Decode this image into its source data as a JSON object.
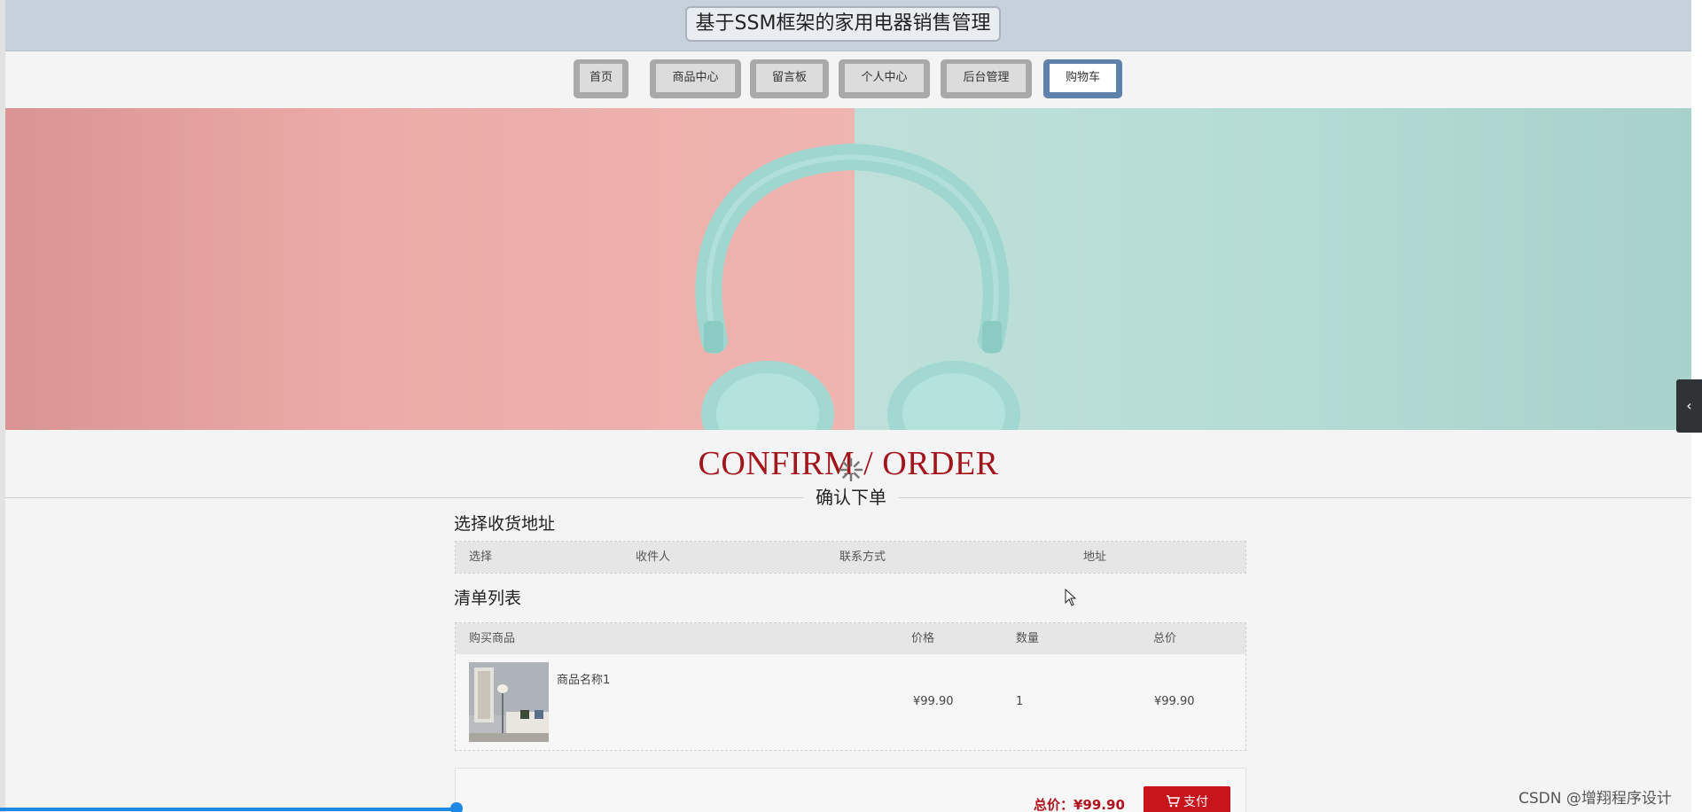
{
  "header": {
    "title": "基于SSM框架的家用电器销售管理"
  },
  "nav": {
    "items": [
      {
        "label": "首页",
        "active": false
      },
      {
        "label": "商品中心",
        "active": false
      },
      {
        "label": "留言板",
        "active": false
      },
      {
        "label": "个人中心",
        "active": false
      },
      {
        "label": "后台管理",
        "active": false
      },
      {
        "label": "购物车",
        "active": true
      }
    ]
  },
  "banner": {
    "colors": {
      "left": "#ebaaa7",
      "right": "#b5dcd5",
      "headphones": "#9fd6cf"
    }
  },
  "confirm": {
    "title_en": "CONFIRM / ORDER",
    "title_cn": "确认下单"
  },
  "address": {
    "section_title": "选择收货地址",
    "columns": [
      "选择",
      "收件人",
      "联系方式",
      "地址"
    ]
  },
  "cart": {
    "section_title": "清单列表",
    "columns": [
      "购买商品",
      "价格",
      "数量",
      "总价"
    ],
    "rows": [
      {
        "name": "商品名称1",
        "price": "¥99.90",
        "qty": "1",
        "subtotal": "¥99.90"
      }
    ]
  },
  "footer": {
    "total": "总价：¥99.90",
    "pay_label": "支付"
  },
  "watermark": "CSDN @增翔程序设计",
  "colors": {
    "accent": "#a3151b",
    "pay": "#c8141b",
    "nav_active_border": "#5f82ad"
  }
}
